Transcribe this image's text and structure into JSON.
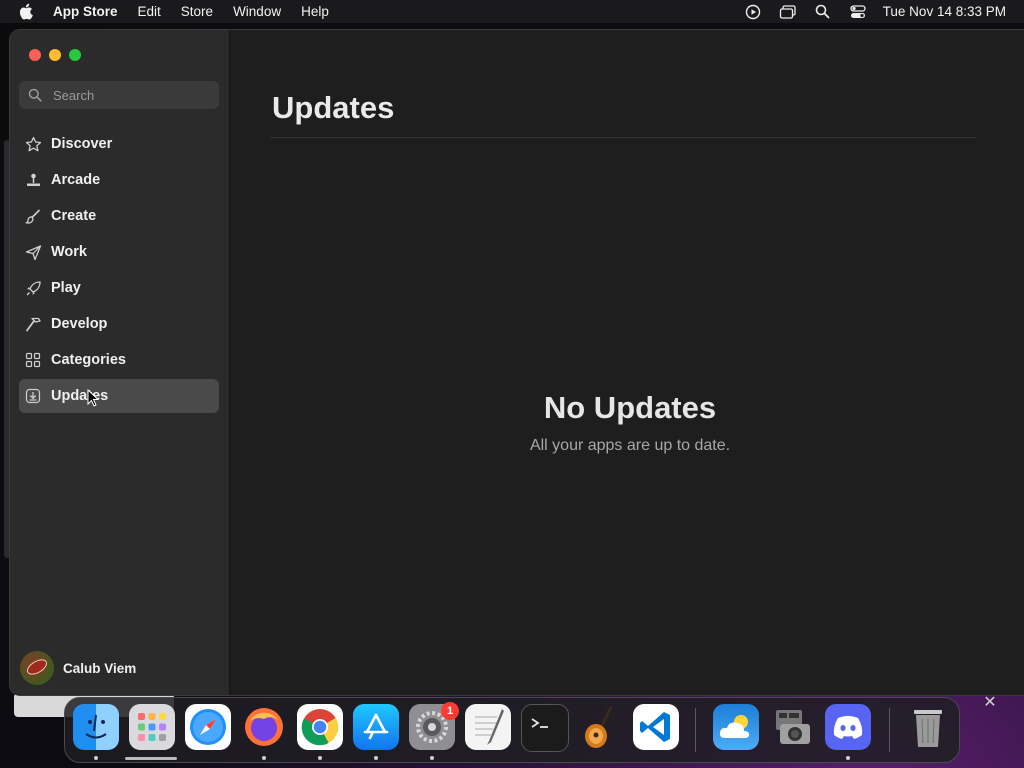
{
  "menubar": {
    "app_name": "App Store",
    "items": [
      "Edit",
      "Store",
      "Window",
      "Help"
    ],
    "clock": "Tue Nov 14  8:33 PM"
  },
  "search": {
    "placeholder": "Search"
  },
  "sidebar": {
    "items": [
      {
        "label": "Discover",
        "icon": "star-icon"
      },
      {
        "label": "Arcade",
        "icon": "joystick-icon"
      },
      {
        "label": "Create",
        "icon": "brush-icon"
      },
      {
        "label": "Work",
        "icon": "paperplane-icon"
      },
      {
        "label": "Play",
        "icon": "rocket-icon"
      },
      {
        "label": "Develop",
        "icon": "hammer-icon"
      },
      {
        "label": "Categories",
        "icon": "grid-icon"
      },
      {
        "label": "Updates",
        "icon": "download-icon",
        "active": true
      }
    ]
  },
  "user": {
    "name": "Calub Viem"
  },
  "main": {
    "title": "Updates",
    "empty_title": "No Updates",
    "empty_subtitle": "All your apps are up to date."
  },
  "dock": {
    "apps": [
      "Finder",
      "Launchpad",
      "Safari",
      "Firefox",
      "Chrome",
      "App Store",
      "System Settings",
      "TextEdit",
      "Terminal",
      "GarageBand",
      "VS Code",
      "Weather",
      "Image Capture",
      "Discord",
      "Trash"
    ],
    "settings_badge": "1"
  }
}
